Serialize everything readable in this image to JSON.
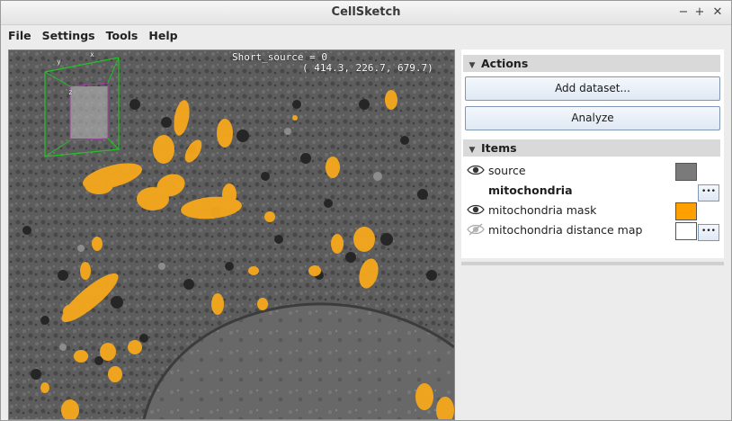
{
  "window": {
    "title": "CellSketch",
    "controls": [
      "−",
      "+",
      "✕"
    ]
  },
  "menubar": {
    "items": [
      "File",
      "Settings",
      "Tools",
      "Help"
    ]
  },
  "viewer": {
    "source_name_text": "Short_source = 0",
    "coords_text": "( 414.3, 226.7, 679.7)",
    "axis_labels": {
      "x": "x",
      "y": "y",
      "z": "z"
    },
    "mask_color": "#f6a81c"
  },
  "actions": {
    "header": "Actions",
    "add_dataset_label": "Add dataset...",
    "analyze_label": "Analyze"
  },
  "items": {
    "header": "Items",
    "rows": [
      {
        "label": "source",
        "bold": false,
        "visible": true,
        "color": "#7a7a7a",
        "has_options": false
      },
      {
        "label": "mitochondria",
        "bold": true,
        "visible": null,
        "color": null,
        "has_options": true
      },
      {
        "label": "mitochondria mask",
        "bold": false,
        "visible": true,
        "color": "#ff9f00",
        "has_options": false
      },
      {
        "label": "mitochondria distance map",
        "bold": false,
        "visible": false,
        "color": "#ffffff",
        "has_options": true
      }
    ]
  }
}
